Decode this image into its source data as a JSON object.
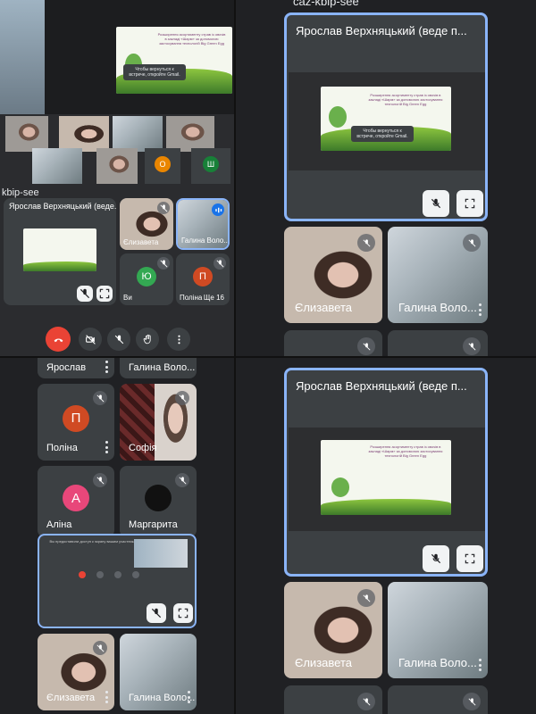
{
  "top_left": {
    "meeting_code": "kbip-see",
    "presenter_name": "Ярослав Верхняцький (веде...",
    "toast_text": "Чтобы вернуться к встрече, откройте Gmail.",
    "small_participants": [
      {
        "name": "Єлизавета"
      },
      {
        "name": "Галина Воло..."
      },
      {
        "name": "Ви",
        "initial": "Ю",
        "color": "#33a852"
      },
      {
        "name": "Поліна",
        "initial": "П",
        "color": "#d04a23"
      }
    ],
    "more_count": "Ще 16",
    "strip_avatars": [
      {
        "initial": "О",
        "color": "#ea8600"
      },
      {
        "initial": "Ш",
        "color": "#188038"
      }
    ]
  },
  "top_right": {
    "header_code": "caz-kbip-see",
    "presenter_title": "Ярослав Верхняцький (веде п...",
    "toast_text": "Чтобы вернуться к встрече, откройте Gmail.",
    "participants": [
      {
        "name": "Єлизавета"
      },
      {
        "name": "Галина Воло..."
      }
    ]
  },
  "bottom_left": {
    "top_names": [
      {
        "name": "Ярослав"
      },
      {
        "name": "Галина Воло..."
      }
    ],
    "grid": [
      {
        "name": "Поліна",
        "initial": "П",
        "color": "#d04a23"
      },
      {
        "name": "Софія"
      },
      {
        "name": "Аліна",
        "initial": "А",
        "color": "#e8477a"
      },
      {
        "name": "Маргарита",
        "initial": "",
        "color": "#111111"
      }
    ],
    "pip_text": "Вы предоставили доступ к экрану вашим участникам",
    "bottom_names": [
      {
        "name": "Єлизавета"
      },
      {
        "name": "Галина Воло..."
      }
    ]
  },
  "bottom_right": {
    "presenter_title": "Ярослав Верхняцький (веде п...",
    "participants": [
      {
        "name": "Єлизавета"
      },
      {
        "name": "Галина Воло..."
      }
    ]
  },
  "slide": {
    "title": "Розширення асортименту страв із овочів в закладі «Шарм» за допомогою застосування технологій Big Green Egg"
  },
  "colors": {
    "accent": "#8ab4f8",
    "hangup": "#ea4335",
    "tile": "#3c4043",
    "background": "#202124"
  }
}
